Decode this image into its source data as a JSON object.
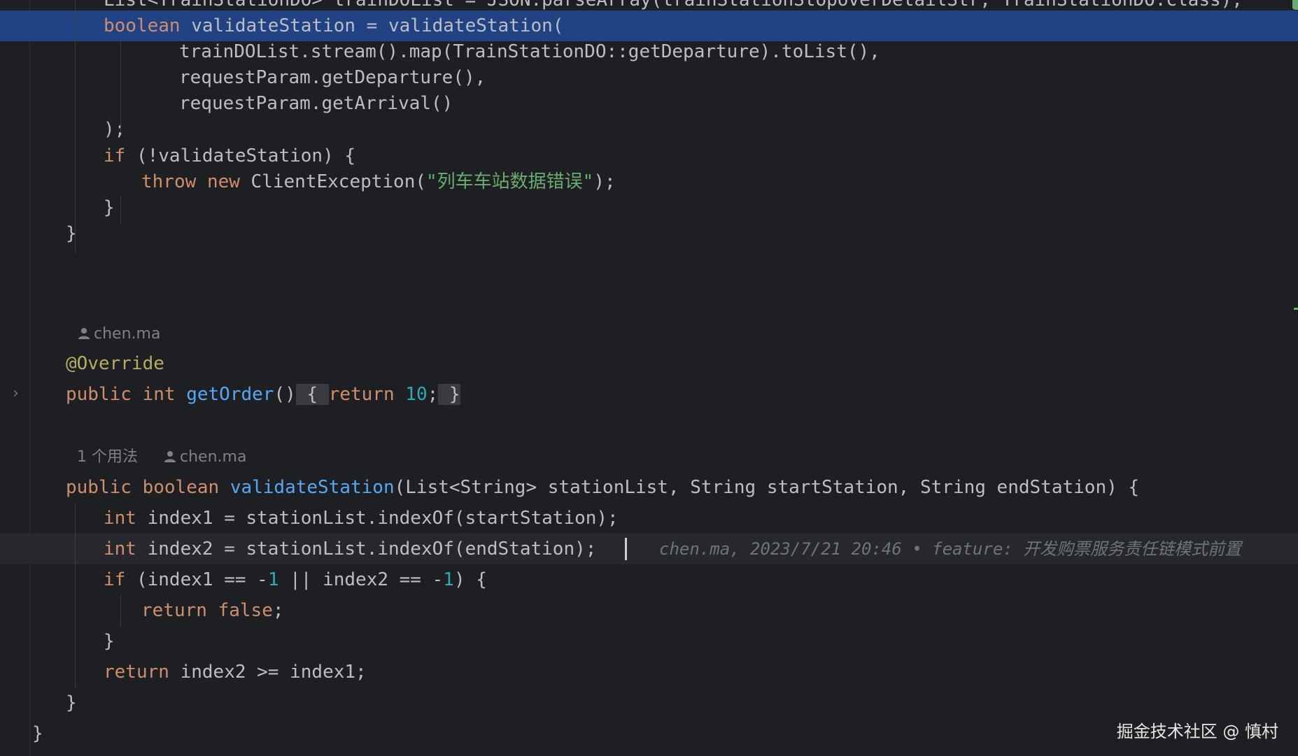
{
  "editor": {
    "lines": [
      {
        "segments": [
          {
            "text": "List<TrainStationDO> trainDOList = JSON.parseArray(trainStationStopoverDetailStr, TrainStationDO.class);",
            "cls": ""
          }
        ]
      },
      {
        "segments": [
          {
            "text": "boolean",
            "cls": "kw"
          },
          {
            "text": " validateStation = validateStation(",
            "cls": ""
          }
        ]
      },
      {
        "segments": [
          {
            "text": "trainDOList.stream().map(TrainStationDO::getDeparture).toList(),",
            "cls": ""
          }
        ]
      },
      {
        "segments": [
          {
            "text": "requestParam.getDeparture(),",
            "cls": ""
          }
        ]
      },
      {
        "segments": [
          {
            "text": "requestParam.getArrival()",
            "cls": ""
          }
        ]
      },
      {
        "segments": [
          {
            "text": ");",
            "cls": ""
          }
        ]
      },
      {
        "segments": [
          {
            "text": "if",
            "cls": "kw"
          },
          {
            "text": " (!validateStation) {",
            "cls": ""
          }
        ]
      },
      {
        "segments": [
          {
            "text": "throw",
            "cls": "kw"
          },
          {
            "text": " ",
            "cls": ""
          },
          {
            "text": "new",
            "cls": "kw"
          },
          {
            "text": " ClientException(",
            "cls": ""
          },
          {
            "text": "\"列车车站数据错误\"",
            "cls": "str"
          },
          {
            "text": ");",
            "cls": ""
          }
        ]
      },
      {
        "segments": [
          {
            "text": "}",
            "cls": ""
          }
        ]
      },
      {
        "segments": [
          {
            "text": "}",
            "cls": ""
          }
        ]
      },
      {
        "segments": [
          {
            "text": "@Override",
            "cls": "ann"
          }
        ]
      },
      {
        "segments": [
          {
            "text": "public",
            "cls": "kw"
          },
          {
            "text": " ",
            "cls": ""
          },
          {
            "text": "int",
            "cls": "kw"
          },
          {
            "text": " ",
            "cls": ""
          },
          {
            "text": "getOrder",
            "cls": "fn"
          },
          {
            "text": "()",
            "cls": ""
          },
          {
            "text": " { ",
            "cls": "brk"
          },
          {
            "text": "return",
            "cls": "kw"
          },
          {
            "text": " ",
            "cls": ""
          },
          {
            "text": "10",
            "cls": "num"
          },
          {
            "text": ";",
            "cls": ""
          },
          {
            "text": " }",
            "cls": "brk"
          }
        ]
      },
      {
        "segments": [
          {
            "text": "public",
            "cls": "kw"
          },
          {
            "text": " ",
            "cls": ""
          },
          {
            "text": "boolean",
            "cls": "kw"
          },
          {
            "text": " ",
            "cls": ""
          },
          {
            "text": "validateStation",
            "cls": "fn"
          },
          {
            "text": "(List<String> stationList, String startStation, String endStation) {",
            "cls": ""
          }
        ]
      },
      {
        "segments": [
          {
            "text": "int",
            "cls": "kw"
          },
          {
            "text": " index1 = stationList.indexOf(startStation);",
            "cls": ""
          }
        ]
      },
      {
        "segments": [
          {
            "text": "int",
            "cls": "kw"
          },
          {
            "text": " index2 = stationList.indexOf(endStation);",
            "cls": ""
          }
        ]
      },
      {
        "segments": [
          {
            "text": "if",
            "cls": "kw"
          },
          {
            "text": " (index1 == -",
            "cls": ""
          },
          {
            "text": "1",
            "cls": "num"
          },
          {
            "text": " || index2 == -",
            "cls": ""
          },
          {
            "text": "1",
            "cls": "num"
          },
          {
            "text": ") {",
            "cls": ""
          }
        ]
      },
      {
        "segments": [
          {
            "text": "return",
            "cls": "kw"
          },
          {
            "text": " ",
            "cls": ""
          },
          {
            "text": "false",
            "cls": "kw"
          },
          {
            "text": ";",
            "cls": ""
          }
        ]
      },
      {
        "segments": [
          {
            "text": "}",
            "cls": ""
          }
        ]
      },
      {
        "segments": [
          {
            "text": "return",
            "cls": "kw"
          },
          {
            "text": " index2 >= index1;",
            "cls": ""
          }
        ]
      },
      {
        "segments": [
          {
            "text": "}",
            "cls": ""
          }
        ]
      },
      {
        "segments": [
          {
            "text": "}",
            "cls": ""
          }
        ]
      }
    ],
    "author_hint_1": "chen.ma",
    "usage_hint": "1 个用法",
    "author_hint_2": "chen.ma",
    "blame": "chen.ma, 2023/7/21 20:46 • feature: 开发购票服务责任链模式前置",
    "fold_icon": "chevron-right-icon",
    "user_icon": "user-icon"
  },
  "watermark": "掘金技术社区 @ 慎村",
  "colors": {
    "background": "#1e1f22",
    "selection": "#214283",
    "keyword": "#cf8e6d",
    "function": "#56a8f5",
    "number": "#2aacb8",
    "string": "#6aab73",
    "annotation": "#b3ae60"
  }
}
